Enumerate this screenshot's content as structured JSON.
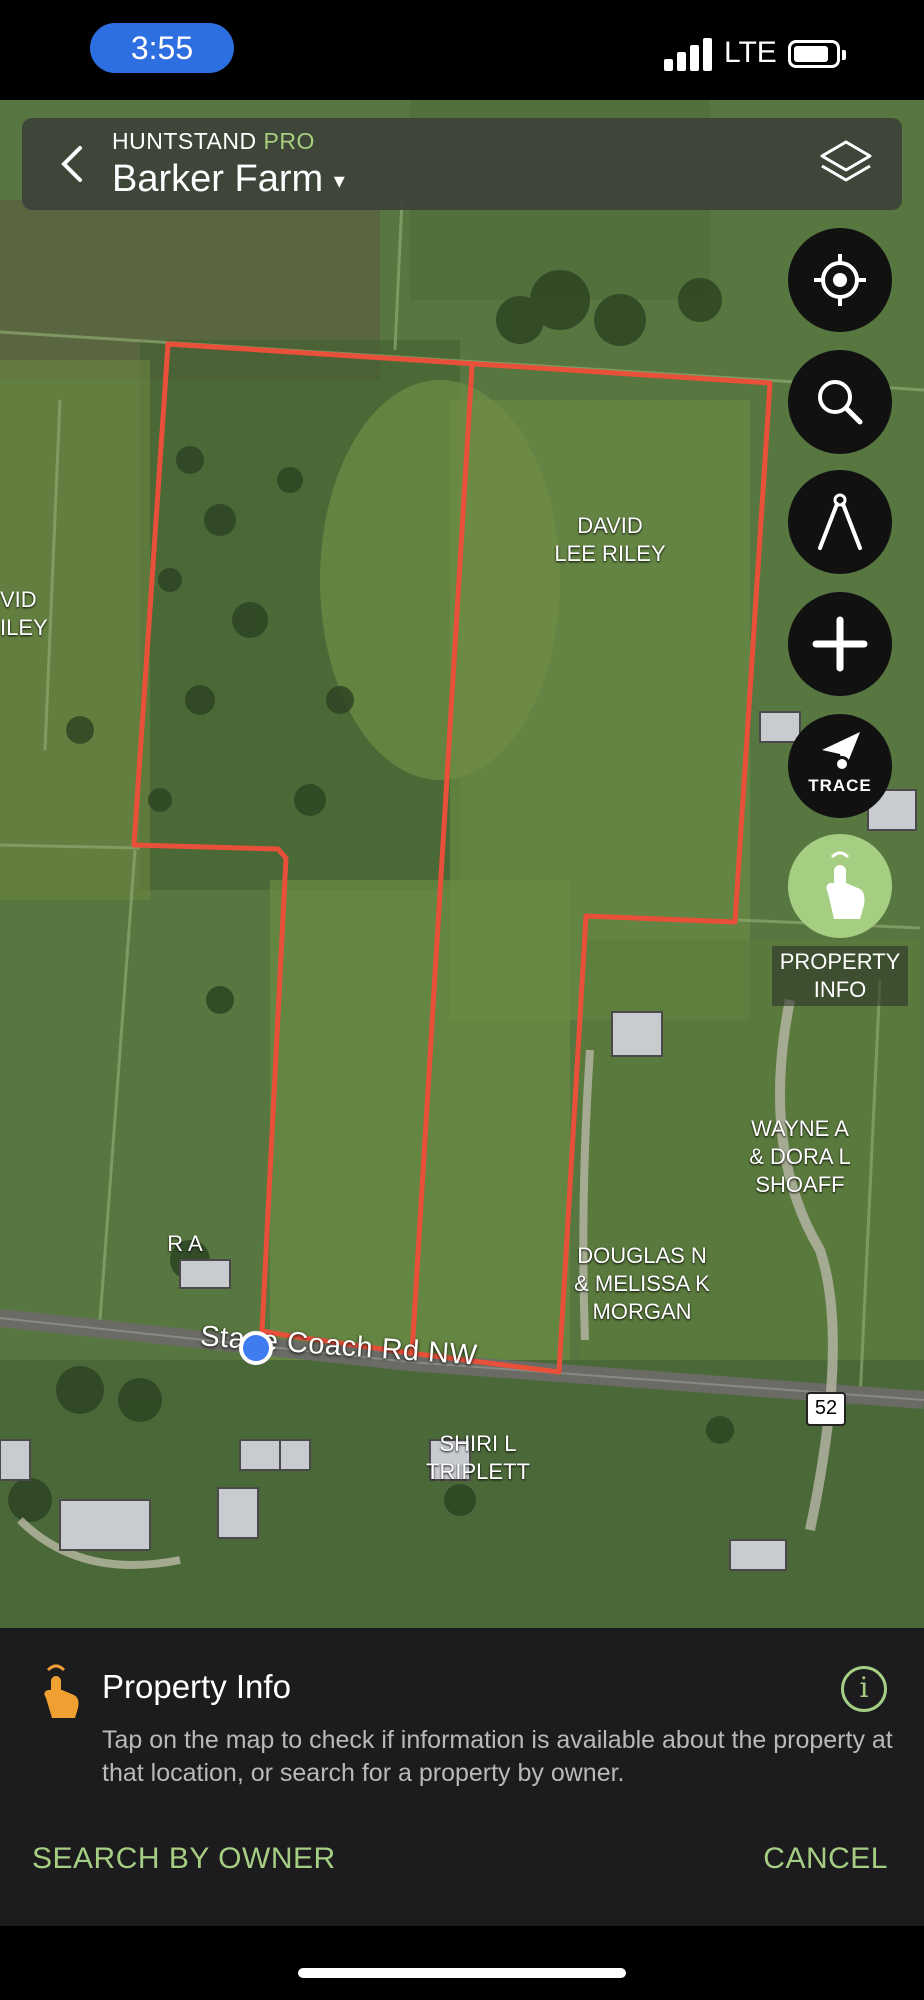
{
  "status_bar": {
    "time": "3:55",
    "network": "LTE",
    "battery_percent": 70
  },
  "header": {
    "brand": "HUNTSTAND",
    "brand_tier": "PRO",
    "property_name": "Barker Farm",
    "dropdown_glyph": "▾"
  },
  "map": {
    "parcel_owners": [
      {
        "id": "riley-main",
        "text": "DAVID\nLEE RILEY"
      },
      {
        "id": "riley-west",
        "text": "VID\nILEY"
      },
      {
        "id": "shoaff",
        "text": "WAYNE A\n& DORA L\nSHOAFF"
      },
      {
        "id": "morgan",
        "text": "DOUGLAS N\n& MELISSA K\nMORGAN"
      },
      {
        "id": "ra",
        "text": "R A"
      },
      {
        "id": "triplett",
        "text": "SHIRI L\nTRIPLETT"
      }
    ],
    "road_name": "Stage Coach Rd NW",
    "route_number": "52",
    "boundary_color": "#e8503a"
  },
  "controls": {
    "trace_label": "TRACE",
    "property_info_label": "PROPERTY\nINFO",
    "icons": [
      "locate-icon",
      "search-icon",
      "compass-icon",
      "plus-icon",
      "trace-icon",
      "tap-hand-icon"
    ]
  },
  "sheet": {
    "title": "Property Info",
    "description": "Tap on the map to check if information is available about the property at that location, or search for a property by owner.",
    "search_by_owner": "SEARCH BY OWNER",
    "cancel": "CANCEL",
    "info_glyph": "i"
  },
  "colors": {
    "accent": "#a6ce83",
    "sheet_bg": "#1c1c1e",
    "location_dot": "#3f7cf0"
  }
}
